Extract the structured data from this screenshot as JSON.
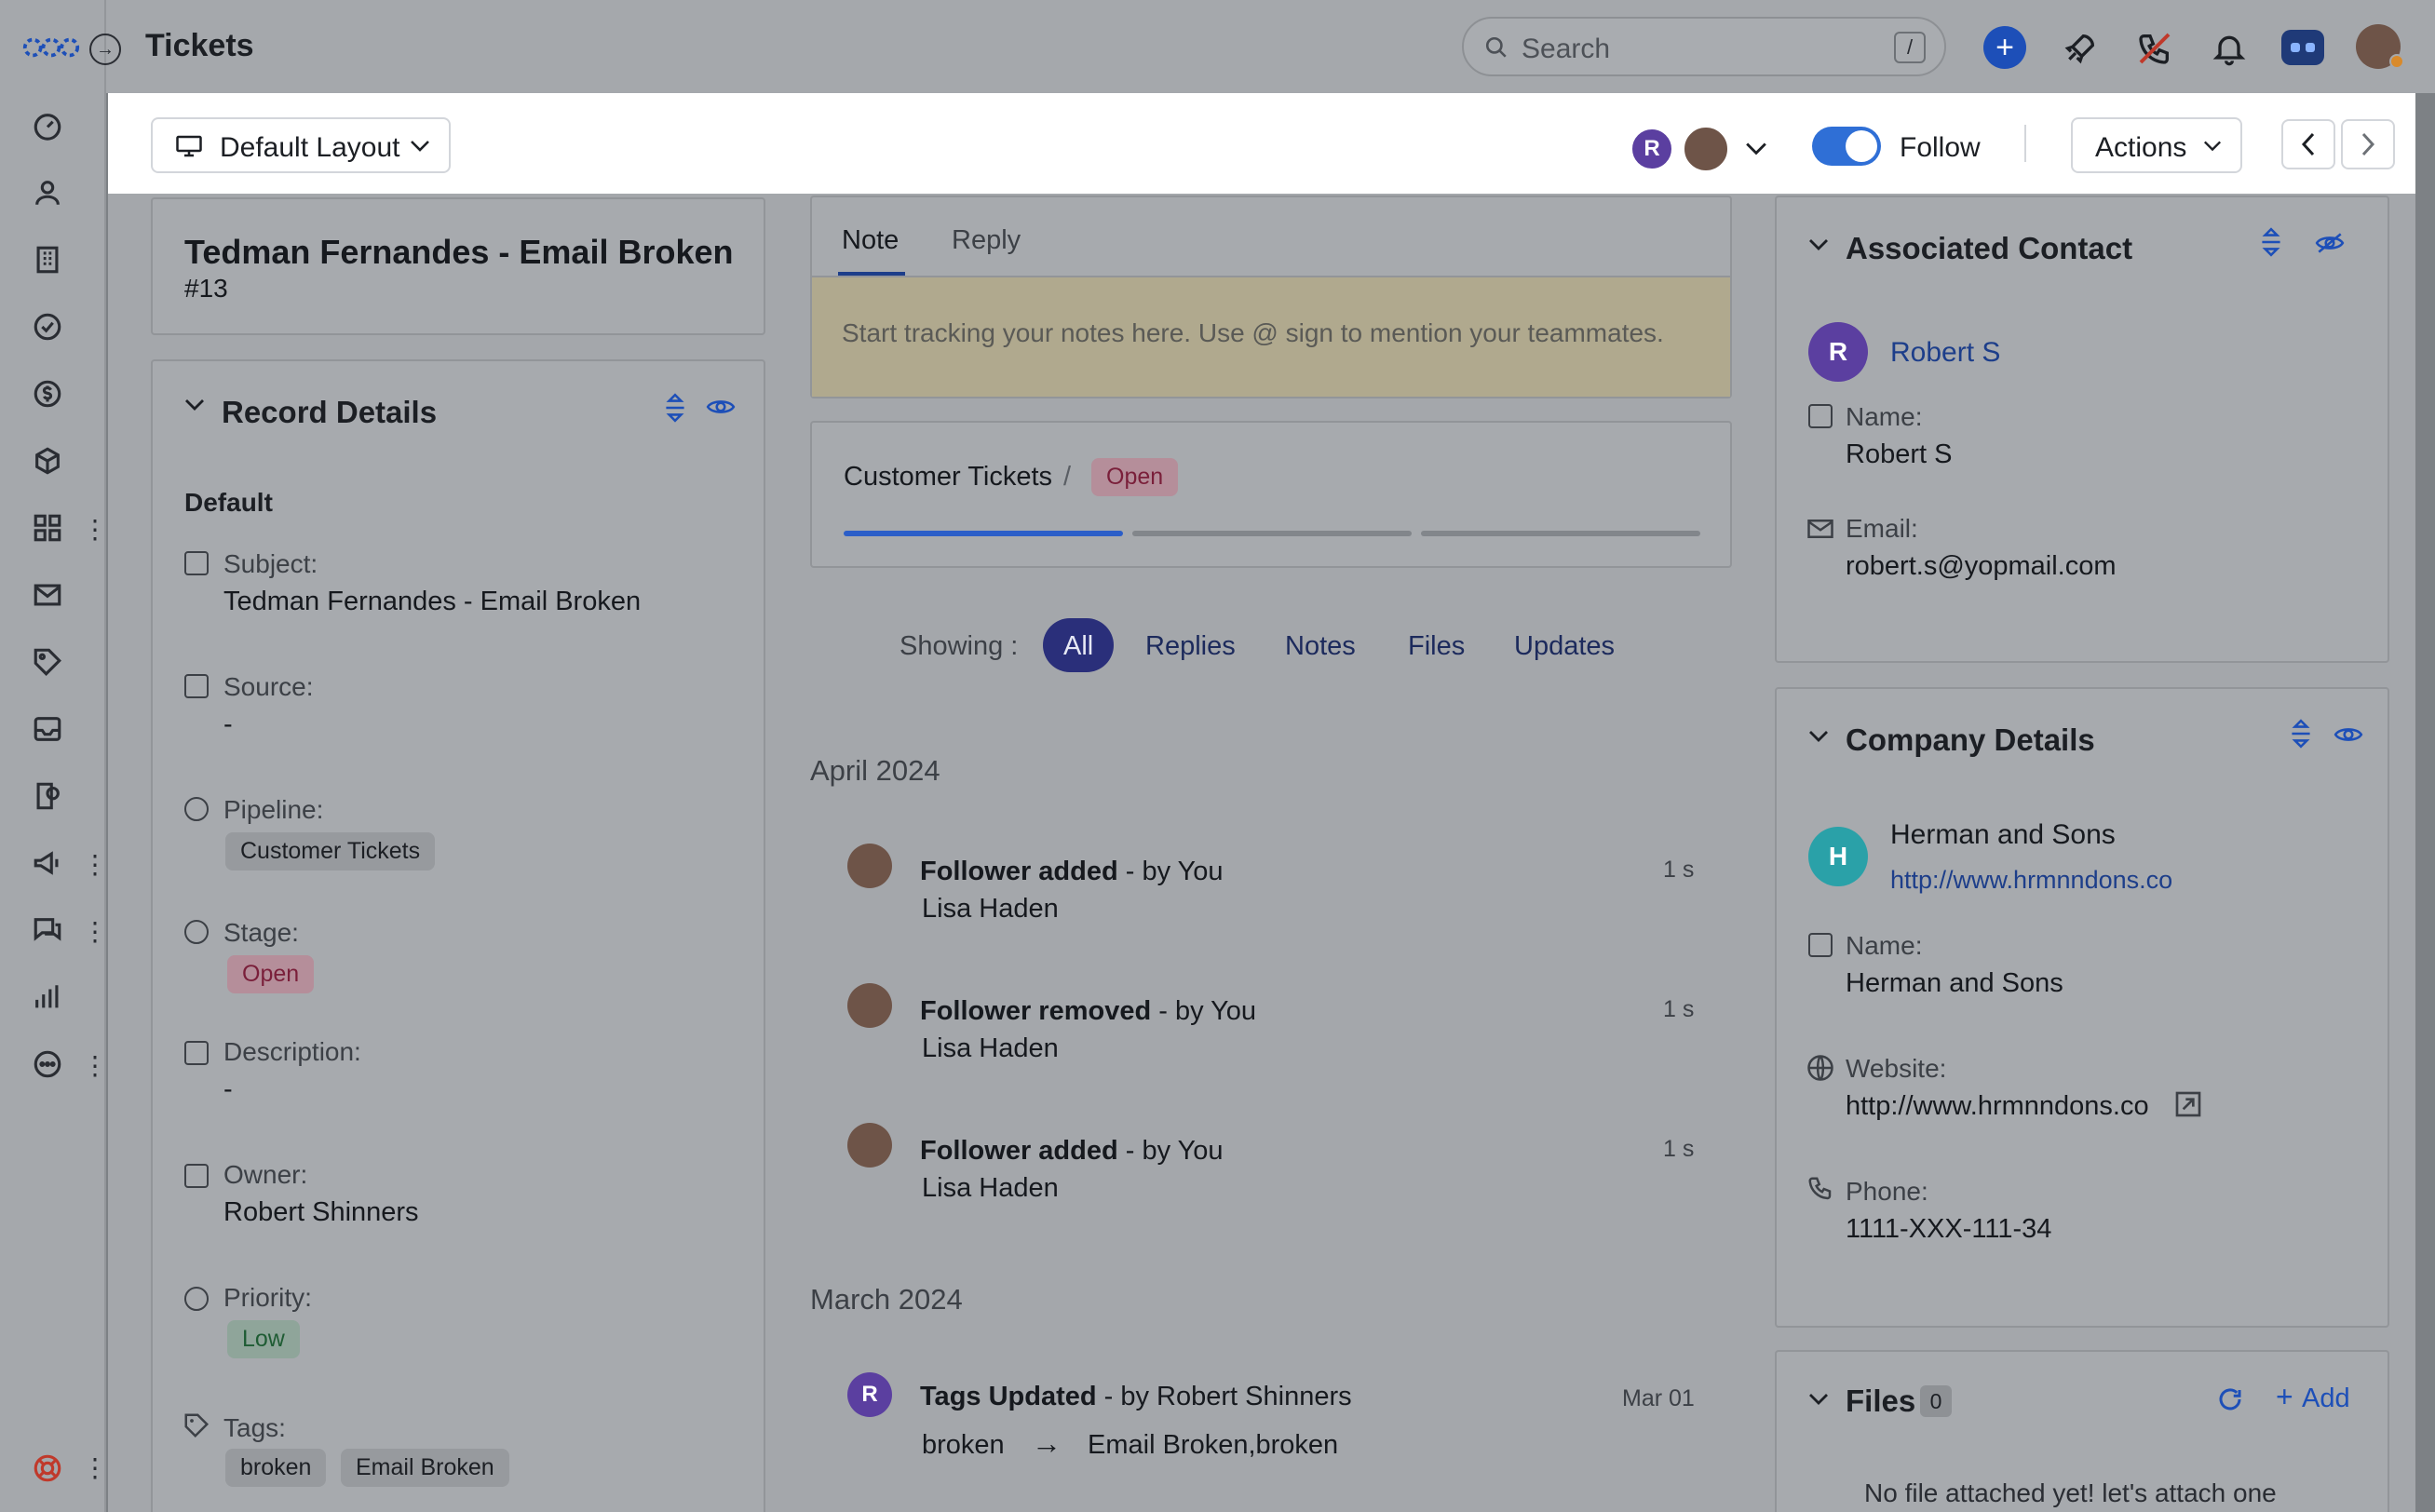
{
  "app": {
    "title": "Tickets"
  },
  "search": {
    "placeholder": "Search",
    "shortcut": "/"
  },
  "toolbar": {
    "layout_label": "Default Layout",
    "follower_initial": "R",
    "follow_label": "Follow",
    "follow_on": true,
    "actions_label": "Actions"
  },
  "ticket": {
    "title": "Tedman Fernandes - Email Broken",
    "number": "#13"
  },
  "record_details": {
    "heading": "Record Details",
    "group": "Default",
    "subject_label": "Subject:",
    "subject_value": "Tedman Fernandes - Email Broken",
    "source_label": "Source:",
    "source_value": "-",
    "pipeline_label": "Pipeline:",
    "pipeline_value": "Customer Tickets",
    "stage_label": "Stage:",
    "stage_value": "Open",
    "description_label": "Description:",
    "description_value": "-",
    "owner_label": "Owner:",
    "owner_value": "Robert Shinners",
    "priority_label": "Priority:",
    "priority_value": "Low",
    "tags_label": "Tags:",
    "tags": [
      "broken",
      "Email Broken"
    ]
  },
  "note": {
    "tabs": [
      "Note",
      "Reply"
    ],
    "active_tab": "Note",
    "placeholder": "Start tracking your notes here. Use @ sign to mention your teammates."
  },
  "pipeline_bar": {
    "pipeline": "Customer Tickets",
    "separator": "/",
    "stage": "Open",
    "stage_index": 1,
    "stage_count": 3
  },
  "filters": {
    "label": "Showing :",
    "options": [
      "All",
      "Replies",
      "Notes",
      "Files",
      "Updates"
    ],
    "active": "All"
  },
  "timeline": {
    "groups": [
      {
        "month": "April 2024",
        "items": [
          {
            "action": "Follower added",
            "by": "- by You",
            "detail": "Lisa Haden",
            "time": "1 s"
          },
          {
            "action": "Follower removed",
            "by": "- by You",
            "detail": "Lisa Haden",
            "time": "1 s"
          },
          {
            "action": "Follower added",
            "by": "- by You",
            "detail": "Lisa Haden",
            "time": "1 s"
          }
        ]
      },
      {
        "month": "March 2024",
        "items": [
          {
            "action": "Tags Updated",
            "by": "- by Robert Shinners",
            "initial": "R",
            "from": "broken",
            "arrow": "→",
            "to": "Email Broken,broken",
            "time": "Mar 01"
          }
        ]
      }
    ]
  },
  "contact": {
    "heading": "Associated Contact",
    "initial": "R",
    "name_link": "Robert S",
    "name_label": "Name:",
    "name_value": "Robert S",
    "email_label": "Email:",
    "email_value": "robert.s@yopmail.com"
  },
  "company": {
    "heading": "Company Details",
    "initial": "H",
    "name": "Herman and Sons",
    "url": "http://www.hrmnndons.co",
    "name_label": "Name:",
    "name_value": "Herman and Sons",
    "website_label": "Website:",
    "website_value": "http://www.hrmnndons.co",
    "phone_label": "Phone:",
    "phone_value": "1111-XXX-111-34"
  },
  "files": {
    "heading": "Files",
    "count": "0",
    "add_label": "Add",
    "empty_text": "No file attached yet! let's attach one"
  },
  "colors": {
    "accent": "#2f6fd6",
    "brand": "#2b4fa8",
    "purple_avatar": "#5b3fa0",
    "teal_avatar": "#2aa1a8"
  }
}
